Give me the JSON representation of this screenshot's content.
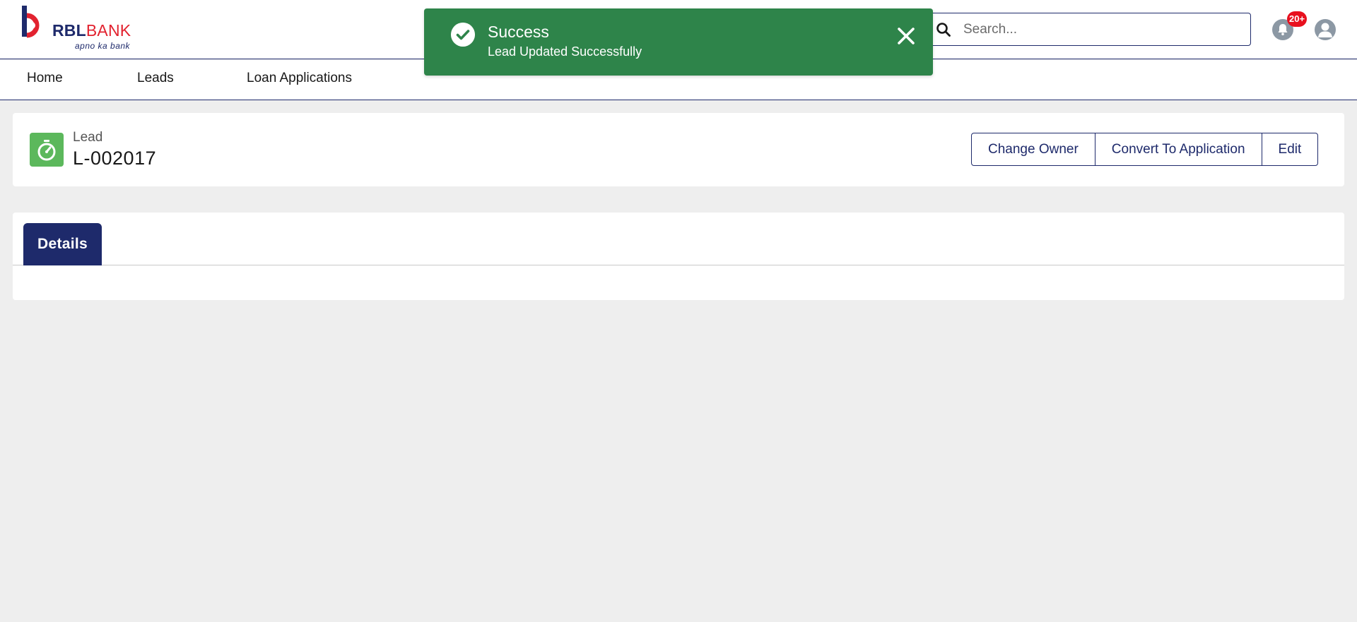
{
  "brand": {
    "name_part1": "RBL",
    "name_part2": "BANK",
    "tagline": "apno ka bank",
    "colors": {
      "navy": "#1e2a6b",
      "red": "#e2222f"
    }
  },
  "search": {
    "placeholder": "Search...",
    "value": "",
    "icon": "search-icon"
  },
  "notifications": {
    "badge": "20+",
    "icon": "bell-icon"
  },
  "user": {
    "icon": "user-avatar-icon"
  },
  "nav": {
    "items": [
      {
        "label": "Home"
      },
      {
        "label": "Leads"
      },
      {
        "label": "Loan Applications"
      }
    ]
  },
  "toast": {
    "title": "Success",
    "message": "Lead Updated Successfully",
    "color": "#2e844a",
    "icon": "check-circle-icon",
    "close_icon": "close-icon"
  },
  "record": {
    "object_label": "Lead",
    "name": "L-002017",
    "icon": "stopwatch-icon",
    "icon_color": "#5cb85c",
    "actions": [
      {
        "label": "Change Owner"
      },
      {
        "label": "Convert To Application"
      },
      {
        "label": "Edit"
      }
    ]
  },
  "tabs": [
    {
      "label": "Details",
      "active": true
    }
  ]
}
